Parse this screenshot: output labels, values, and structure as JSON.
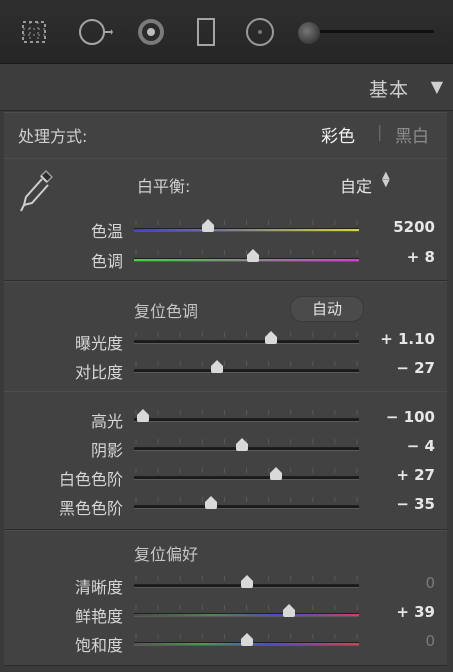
{
  "panel": {
    "title": "基本",
    "toggle_icon": "▼"
  },
  "toolstrip": {
    "tools": [
      "crop-overlay-icon",
      "spot-removal-icon",
      "red-eye-icon",
      "graduated-filter-icon",
      "radial-filter-icon",
      "adjustment-brush-icon"
    ]
  },
  "treatment": {
    "label": "处理方式:",
    "color": "彩色",
    "separator": "|",
    "bw": "黑白"
  },
  "white_balance": {
    "label": "白平衡:",
    "value": "自定",
    "spin": "◆"
  },
  "wb_sliders": [
    {
      "label": "色温",
      "value": "5200",
      "level": 0.33,
      "track": "temp"
    },
    {
      "label": "色调",
      "value": "+ 8",
      "level": 0.53,
      "track": "tint"
    }
  ],
  "tone": {
    "title": "复位色调",
    "auto": "自动",
    "sliders": [
      {
        "label": "曝光度",
        "value": "+ 1.10",
        "level": 0.61
      },
      {
        "label": "对比度",
        "value": "− 27",
        "level": 0.37
      }
    ]
  },
  "highlights": {
    "sliders": [
      {
        "label": "高光",
        "value": "− 100",
        "level": 0.04
      },
      {
        "label": "阴影",
        "value": "− 4",
        "level": 0.48
      },
      {
        "label": "白色色阶",
        "value": "+ 27",
        "level": 0.63
      },
      {
        "label": "黑色色阶",
        "value": "− 35",
        "level": 0.34
      }
    ]
  },
  "presence": {
    "title": "复位偏好",
    "sliders": [
      {
        "label": "清晰度",
        "value": "0",
        "level": 0.5,
        "dim": true
      },
      {
        "label": "鲜艳度",
        "value": "+ 39",
        "level": 0.69,
        "track": "vib"
      },
      {
        "label": "饱和度",
        "value": "0",
        "level": 0.5,
        "dim": true,
        "track": "sat"
      }
    ]
  },
  "colors": {
    "temp_start": "#3b3bd6",
    "temp_end": "#d6d63b",
    "tint_start": "#3bd63b",
    "tint_end": "#d63bd6",
    "vib_start": "#4a4a4a",
    "vib_end": "#d63b6a"
  }
}
